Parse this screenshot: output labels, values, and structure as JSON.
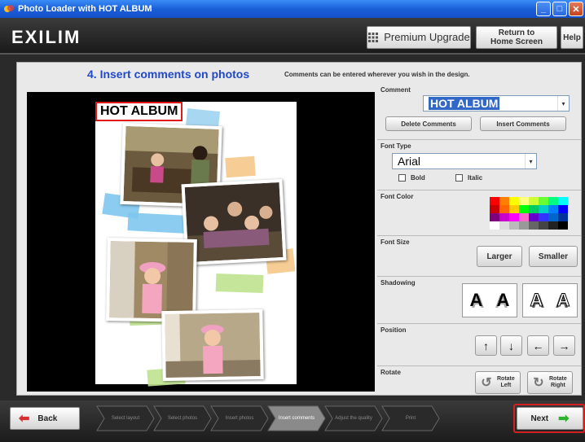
{
  "window": {
    "title": "Photo Loader with HOT ALBUM",
    "controls": [
      "_",
      "□",
      "✕"
    ]
  },
  "header": {
    "logo": "EXILIM",
    "premium_label": "Premium Upgrade",
    "home_label_1": "Return to",
    "home_label_2": "Home Screen",
    "help_label": "Help"
  },
  "main": {
    "step_title": "4. Insert comments on photos",
    "step_desc": "Comments can be entered wherever you wish in the design.",
    "album_title": "HOT ALBUM"
  },
  "side": {
    "comment": {
      "label": "Comment",
      "value": "HOT ALBUM",
      "delete_label": "Delete Comments",
      "insert_label": "Insert Comments"
    },
    "font_type": {
      "label": "Font Type",
      "value": "Arial",
      "bold_label": "Bold",
      "italic_label": "Italic"
    },
    "font_color": {
      "label": "Font Color",
      "palette": [
        "#ff0000",
        "#ff8000",
        "#ffff00",
        "#ffff80",
        "#ccff33",
        "#66ff33",
        "#00ff80",
        "#00ffff",
        "#cc0000",
        "#ff6600",
        "#ffcc00",
        "#00ff00",
        "#00cc66",
        "#00cccc",
        "#0080ff",
        "#0000ff",
        "#800080",
        "#cc00cc",
        "#ff00ff",
        "#ff66cc",
        "#6600cc",
        "#3333ff",
        "#0066cc",
        "#003399",
        "#ffffff",
        "#dddddd",
        "#bbbbbb",
        "#999999",
        "#666666",
        "#444444",
        "#222222",
        "#000000"
      ]
    },
    "font_size": {
      "label": "Font Size",
      "larger_label": "Larger",
      "smaller_label": "Smaller"
    },
    "shadowing": {
      "label": "Shadowing",
      "glyph": "A"
    },
    "position": {
      "label": "Position",
      "up": "↑",
      "down": "↓",
      "left": "←",
      "right": "→"
    },
    "rotate": {
      "label": "Rotate",
      "left_1": "Rotate",
      "left_2": "Left",
      "right_1": "Rotate",
      "right_2": "Right"
    }
  },
  "bottom": {
    "back_label": "Back",
    "next_label": "Next",
    "steps": [
      {
        "label": "Select layout",
        "active": false
      },
      {
        "label": "Select photos",
        "active": false
      },
      {
        "label": "Insert photos",
        "active": false
      },
      {
        "label": "Insert comments",
        "active": true
      },
      {
        "label": "Adjust the quality",
        "active": false
      },
      {
        "label": "Print",
        "active": false
      }
    ]
  },
  "colors": {
    "accent": "#2148c8",
    "highlight": "#d42020",
    "header": "#1a1a1a"
  }
}
